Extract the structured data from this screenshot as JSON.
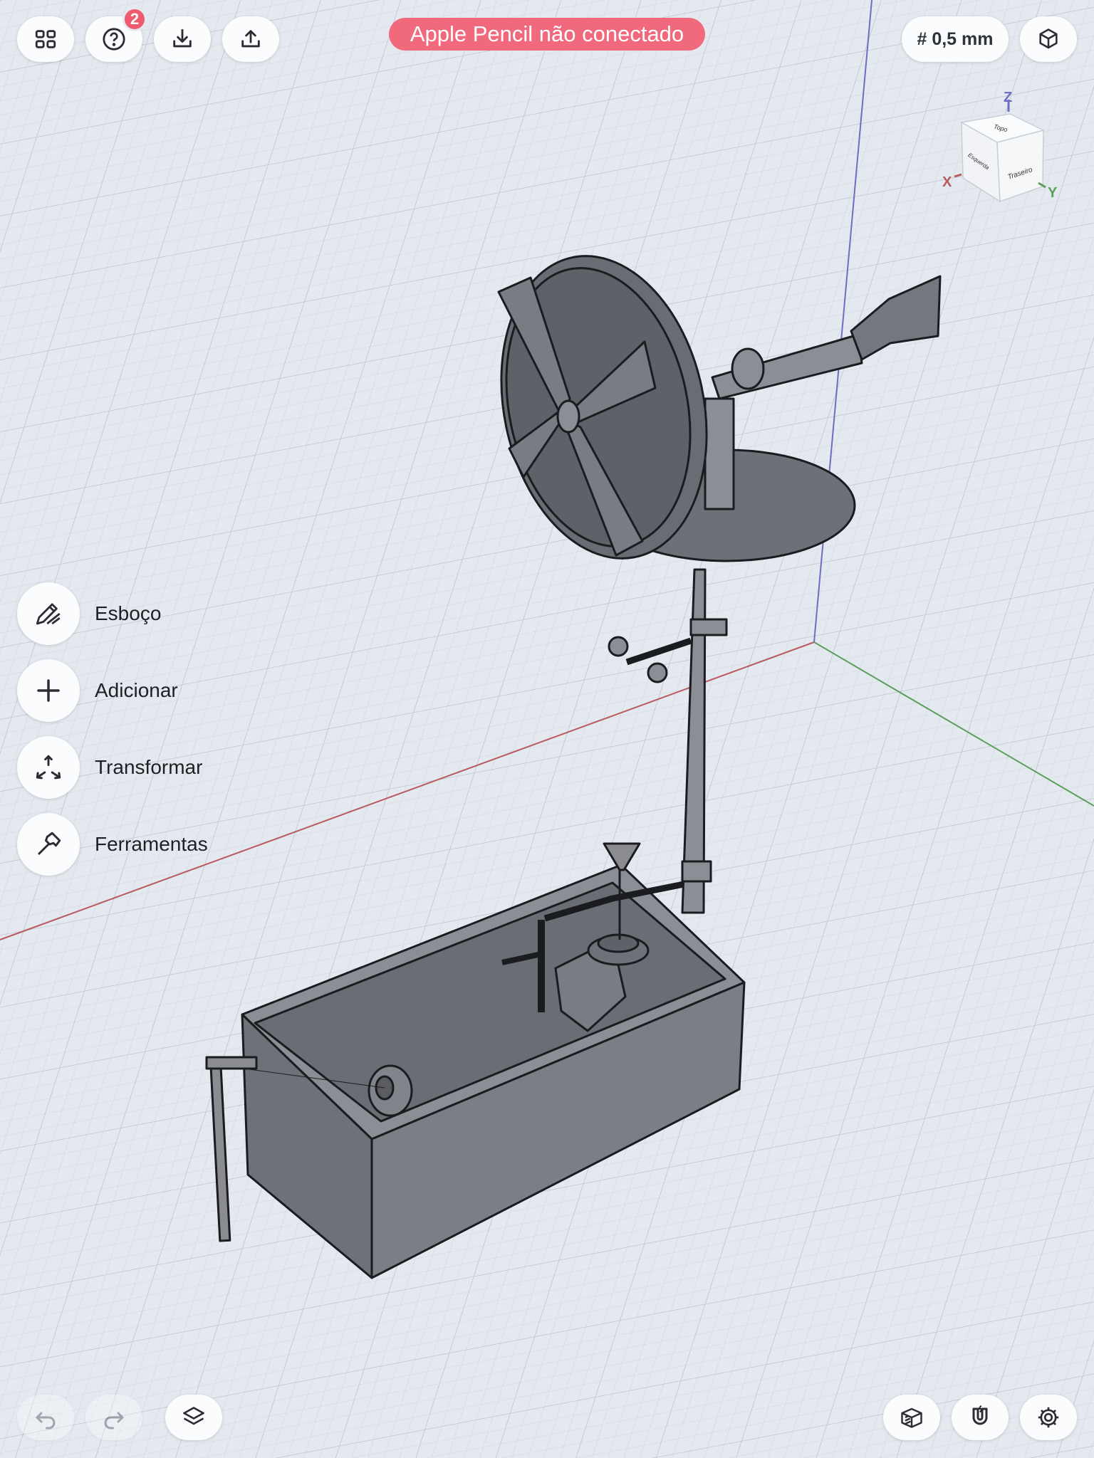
{
  "toolbar": {
    "help_badge": "2",
    "status_pill": "Apple Pencil não conectado",
    "grid_label": "# 0,5 mm"
  },
  "view_cube": {
    "top": "Topo",
    "left": "Esquerda",
    "back": "Traseiro",
    "axis_x": "X",
    "axis_y": "Y",
    "axis_z": "Z"
  },
  "tools": [
    {
      "label": "Esboço",
      "icon": "pencil-sketch-icon"
    },
    {
      "label": "Adicionar",
      "icon": "plus-icon"
    },
    {
      "label": "Transformar",
      "icon": "transform-arrows-icon"
    },
    {
      "label": "Ferramentas",
      "icon": "hammer-icon"
    }
  ],
  "bottom_bar": {
    "undo_icon": "undo-icon",
    "redo_icon": "redo-icon",
    "layers_icon": "layers-icon",
    "section_icon": "section-view-icon",
    "snap_icon": "magnet-snap-icon",
    "settings_icon": "gear-icon"
  },
  "colors": {
    "axis_x": "#b85a5f",
    "axis_y": "#5aa05a",
    "axis_z": "#6a6fc0",
    "pill": "#f0697c",
    "model": "#6e7078"
  }
}
